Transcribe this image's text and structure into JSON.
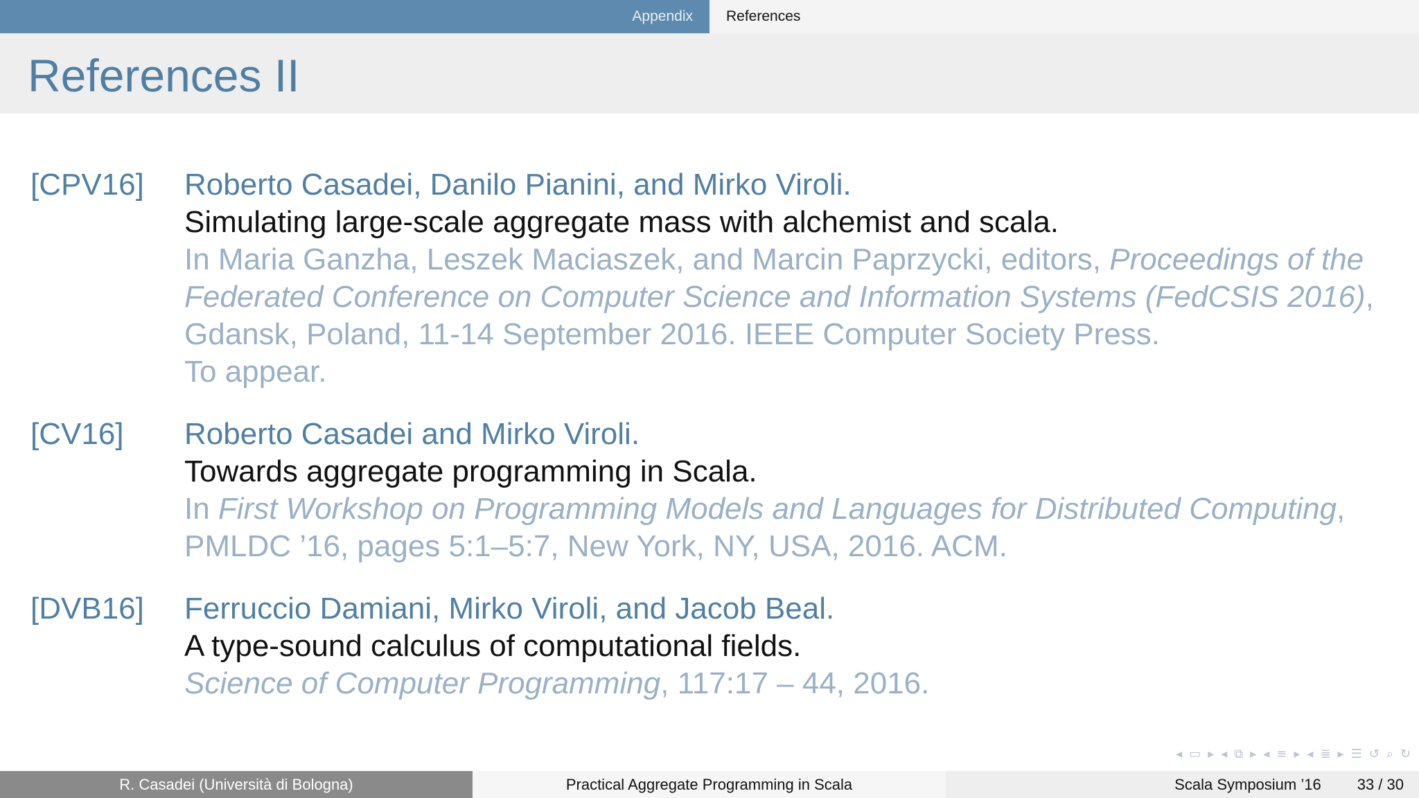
{
  "nav": {
    "section": "Appendix",
    "subsection": "References"
  },
  "frame": {
    "title": "References II"
  },
  "references": [
    {
      "key": "[CPV16]",
      "authors": "Roberto Casadei, Danilo Pianini, and Mirko Viroli.",
      "title": "Simulating large-scale aggregate mass with alchemist and scala.",
      "venue_prefix": "In Maria Ganzha, Leszek Maciaszek, and Marcin Paprzycki, editors, ",
      "venue_italic": "Proceedings of the Federated Conference on Computer Science and Information Systems (FedCSIS 2016)",
      "venue_suffix": ", Gdansk, Poland, 11-14 September 2016. IEEE Computer Society Press.",
      "note": "To appear."
    },
    {
      "key": "[CV16]",
      "authors": "Roberto Casadei and Mirko Viroli.",
      "title": "Towards aggregate programming in Scala.",
      "venue_prefix": "In ",
      "venue_italic": "First Workshop on Programming Models and Languages for Distributed Computing",
      "venue_suffix": ", PMLDC ’16, pages 5:1–5:7, New York, NY, USA, 2016. ACM.",
      "note": ""
    },
    {
      "key": "[DVB16]",
      "authors": "Ferruccio Damiani, Mirko Viroli, and Jacob Beal.",
      "title": "A type-sound calculus of computational fields.",
      "venue_prefix": "",
      "venue_italic": "Science of Computer Programming",
      "venue_suffix": ", 117:17 – 44, 2016.",
      "note": ""
    }
  ],
  "footer": {
    "author": "R. Casadei  (Università di Bologna)",
    "talk_title": "Practical Aggregate Programming in Scala",
    "event": "Scala Symposium ’16",
    "page": "33 / 30"
  },
  "colors": {
    "nav_left_bg": "#5f8aaf",
    "title_color": "#4f7fa5",
    "venue_color": "#9ab0c5",
    "footer_author_bg": "#8a8a8a"
  }
}
